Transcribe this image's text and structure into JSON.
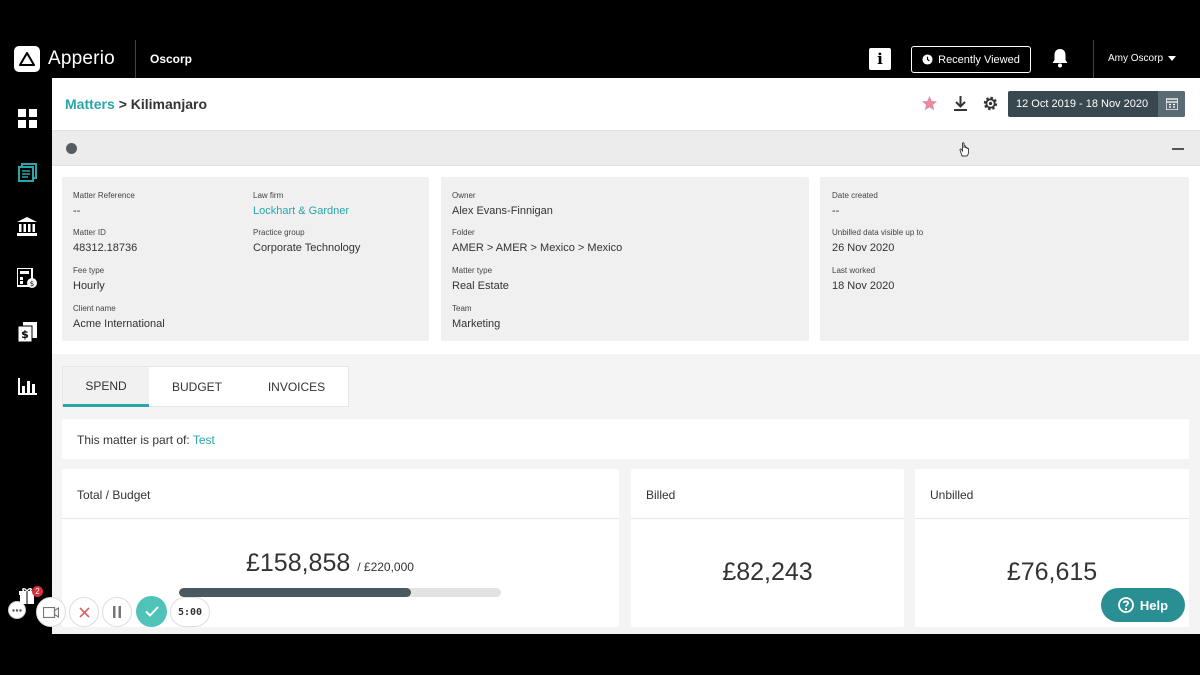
{
  "app": {
    "name": "Apperio",
    "company": "Oscorp"
  },
  "topbar": {
    "info_label": "i",
    "recent_label": "Recently Viewed",
    "user_name": "Amy Oscorp"
  },
  "header": {
    "breadcrumb_root": "Matters",
    "breadcrumb_sep": ">",
    "breadcrumb_current": "Kilimanjaro",
    "date_range": "12 Oct 2019 - 18 Nov 2020"
  },
  "details": {
    "matter_reference": {
      "label": "Matter Reference",
      "value": "--"
    },
    "law_firm": {
      "label": "Law firm",
      "value": "Lockhart & Gardner"
    },
    "matter_id": {
      "label": "Matter ID",
      "value": "48312.18736"
    },
    "practice_group": {
      "label": "Practice group",
      "value": "Corporate Technology"
    },
    "fee_type": {
      "label": "Fee type",
      "value": "Hourly"
    },
    "client_name": {
      "label": "Client name",
      "value": "Acme International"
    },
    "owner": {
      "label": "Owner",
      "value": "Alex Evans-Finnigan"
    },
    "folder": {
      "label": "Folder",
      "value": "AMER > AMER > Mexico > Mexico"
    },
    "matter_type": {
      "label": "Matter type",
      "value": "Real Estate"
    },
    "team": {
      "label": "Team",
      "value": "Marketing"
    },
    "date_created": {
      "label": "Date created",
      "value": "--"
    },
    "unbilled_visible": {
      "label": "Unbilled data visible up to",
      "value": "26 Nov 2020"
    },
    "last_worked": {
      "label": "Last worked",
      "value": "18 Nov 2020"
    }
  },
  "tabs": [
    {
      "label": "SPEND",
      "active": true
    },
    {
      "label": "BUDGET",
      "active": false
    },
    {
      "label": "INVOICES",
      "active": false
    }
  ],
  "partof": {
    "text": "This matter is part of:",
    "link": "Test"
  },
  "metrics": {
    "total": {
      "title": "Total / Budget",
      "value": "£158,858",
      "budget": "/ £220,000",
      "progress": 0.72
    },
    "billed": {
      "title": "Billed",
      "value": "£82,243"
    },
    "unbilled": {
      "title": "Unbilled",
      "value": "£76,615"
    }
  },
  "recorder": {
    "badge_count": "2",
    "timer": "5:00"
  },
  "help": {
    "label": "Help"
  },
  "colors": {
    "accent": "#2aa5a8",
    "dark": "#39474f",
    "help": "#2a8f93"
  }
}
